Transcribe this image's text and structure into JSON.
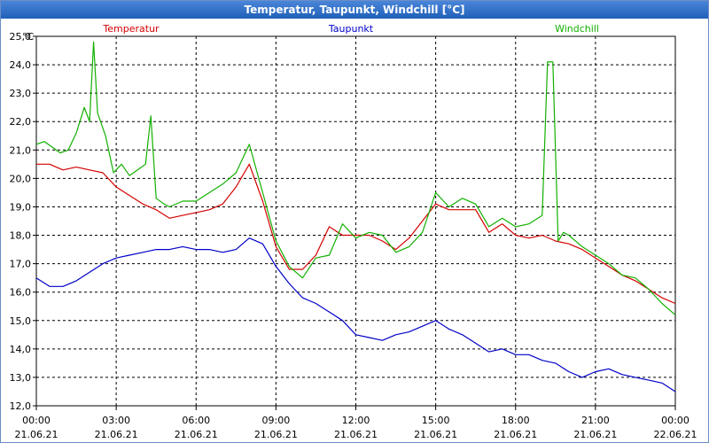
{
  "window": {
    "title": "Temperatur, Taupunkt, Windchill [°C]"
  },
  "chart_data": {
    "type": "line",
    "title": "Temperatur, Taupunkt, Windchill [°C]",
    "ylabel": "°C",
    "ylim": [
      12.0,
      25.0
    ],
    "y_ticks": [
      "12,0",
      "13,0",
      "14,0",
      "15,0",
      "16,0",
      "17,0",
      "18,0",
      "19,0",
      "20,0",
      "21,0",
      "22,0",
      "23,0",
      "24,0",
      "25,0"
    ],
    "x_ticks": [
      {
        "time": "00:00",
        "date": "21.06.21"
      },
      {
        "time": "03:00",
        "date": "21.06.21"
      },
      {
        "time": "06:00",
        "date": "21.06.21"
      },
      {
        "time": "09:00",
        "date": "21.06.21"
      },
      {
        "time": "12:00",
        "date": "21.06.21"
      },
      {
        "time": "15:00",
        "date": "21.06.21"
      },
      {
        "time": "18:00",
        "date": "21.06.21"
      },
      {
        "time": "21:00",
        "date": "21.06.21"
      },
      {
        "time": "00:00",
        "date": "22.06.21"
      }
    ],
    "xlim_hours": [
      0,
      24
    ],
    "grid": true,
    "legend_position": "top",
    "series": [
      {
        "name": "Temperatur",
        "color": "#d40000",
        "x": [
          0,
          0.5,
          1,
          1.5,
          2,
          2.5,
          3,
          3.5,
          4,
          4.5,
          5,
          5.5,
          6,
          6.5,
          7,
          7.5,
          8,
          8.5,
          9,
          9.5,
          10,
          10.5,
          11,
          11.5,
          12,
          12.5,
          13,
          13.5,
          14,
          14.5,
          15,
          15.5,
          16,
          16.5,
          17,
          17.5,
          18,
          18.5,
          19,
          19.5,
          20,
          20.5,
          21,
          21.5,
          22,
          22.5,
          23,
          23.5,
          24
        ],
        "values": [
          20.5,
          20.5,
          20.3,
          20.4,
          20.3,
          20.2,
          19.7,
          19.4,
          19.1,
          18.9,
          18.6,
          18.7,
          18.8,
          18.9,
          19.1,
          19.7,
          20.5,
          19.2,
          17.6,
          16.8,
          16.8,
          17.3,
          18.3,
          18.0,
          18.0,
          18.0,
          17.8,
          17.5,
          17.9,
          18.5,
          19.1,
          18.9,
          18.9,
          18.9,
          18.1,
          18.4,
          18.0,
          17.9,
          18.0,
          17.8,
          17.7,
          17.5,
          17.2,
          16.9,
          16.6,
          16.4,
          16.1,
          15.8,
          15.6
        ]
      },
      {
        "name": "Taupunkt",
        "color": "#0000c8",
        "x": [
          0,
          0.5,
          1,
          1.5,
          2,
          2.5,
          3,
          3.5,
          4,
          4.5,
          5,
          5.5,
          6,
          6.5,
          7,
          7.5,
          8,
          8.5,
          9,
          9.5,
          10,
          10.5,
          11,
          11.5,
          12,
          12.5,
          13,
          13.5,
          14,
          14.5,
          15,
          15.5,
          16,
          16.5,
          17,
          17.5,
          18,
          18.5,
          19,
          19.5,
          20,
          20.5,
          21,
          21.5,
          22,
          22.5,
          23,
          23.5,
          24
        ],
        "values": [
          16.5,
          16.2,
          16.2,
          16.4,
          16.7,
          17.0,
          17.2,
          17.3,
          17.4,
          17.5,
          17.5,
          17.6,
          17.5,
          17.5,
          17.4,
          17.5,
          17.9,
          17.7,
          16.9,
          16.3,
          15.8,
          15.6,
          15.3,
          15.0,
          14.5,
          14.4,
          14.3,
          14.5,
          14.6,
          14.8,
          15.0,
          14.7,
          14.5,
          14.2,
          13.9,
          14.0,
          13.8,
          13.8,
          13.6,
          13.5,
          13.2,
          13.0,
          13.2,
          13.3,
          13.1,
          13.0,
          12.9,
          12.8,
          12.5
        ]
      },
      {
        "name": "Windchill",
        "color": "#12b000",
        "x": [
          0,
          0.3,
          0.6,
          0.9,
          1.2,
          1.5,
          1.8,
          2.0,
          2.15,
          2.3,
          2.6,
          2.9,
          3.2,
          3.5,
          3.8,
          4.1,
          4.3,
          4.5,
          4.8,
          5.0,
          5.5,
          6,
          6.5,
          7,
          7.5,
          8.0,
          8.5,
          9,
          9.5,
          10,
          10.5,
          11,
          11.5,
          12,
          12.5,
          13,
          13.5,
          14,
          14.5,
          15,
          15.5,
          16,
          16.5,
          17,
          17.5,
          18,
          18.5,
          19,
          19.2,
          19.4,
          19.6,
          19.8,
          20,
          20.5,
          21,
          21.5,
          22,
          22.5,
          23,
          23.5,
          24
        ],
        "values": [
          21.2,
          21.3,
          21.1,
          20.9,
          21.0,
          21.6,
          22.5,
          22.0,
          24.8,
          22.3,
          21.5,
          20.2,
          20.5,
          20.1,
          20.3,
          20.5,
          22.2,
          19.3,
          19.1,
          19.0,
          19.2,
          19.2,
          19.5,
          19.8,
          20.2,
          21.2,
          19.5,
          17.8,
          16.9,
          16.5,
          17.2,
          17.3,
          18.4,
          17.9,
          18.1,
          18.0,
          17.4,
          17.6,
          18.1,
          19.5,
          19.0,
          19.3,
          19.1,
          18.3,
          18.6,
          18.3,
          18.4,
          18.7,
          24.1,
          24.1,
          17.8,
          18.1,
          18.0,
          17.6,
          17.3,
          17.0,
          16.6,
          16.5,
          16.1,
          15.6,
          15.2
        ]
      }
    ]
  }
}
